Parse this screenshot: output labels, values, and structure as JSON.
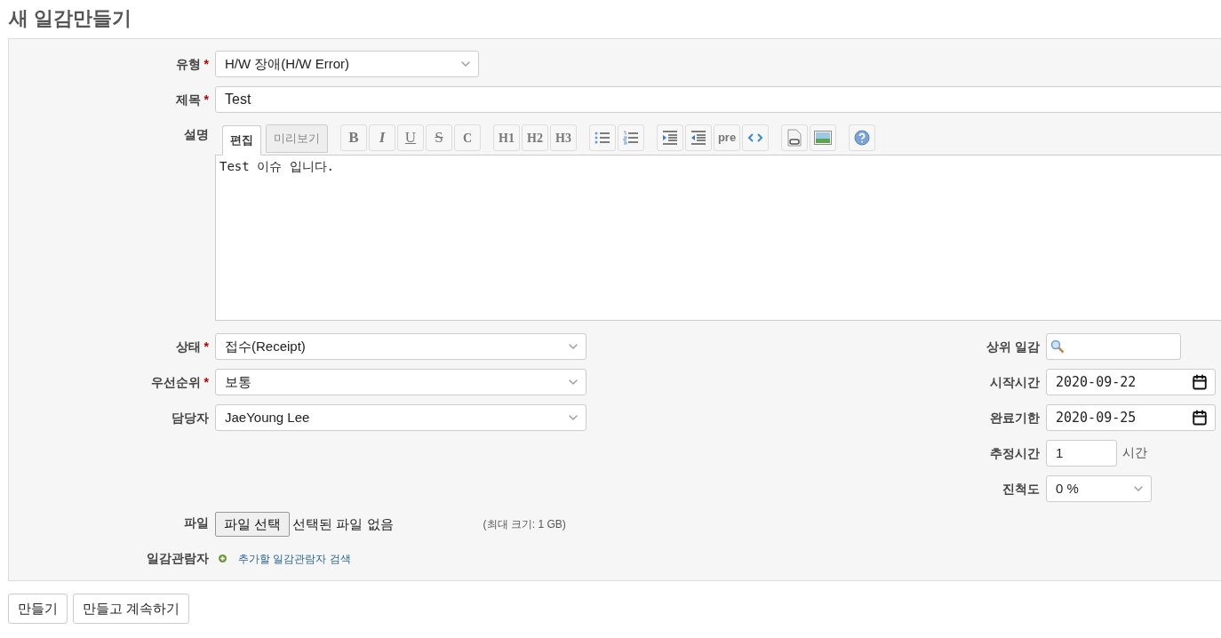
{
  "title": "새 일감만들기",
  "main_fields": [
    {
      "label": "유형",
      "required_mark": "*",
      "kind": "select",
      "value": "H/W 장애(H/W Error)"
    },
    {
      "label": "제목",
      "required_mark": "*",
      "kind": "text",
      "value": "Test"
    }
  ],
  "description": {
    "label": "설명",
    "tabs": [
      {
        "label": "편집",
        "selected": true
      },
      {
        "label": "미리보기",
        "selected": false
      }
    ],
    "toolbar": [
      [
        {
          "kind": "bold",
          "label": "B"
        },
        {
          "kind": "italic",
          "label": "I"
        },
        {
          "kind": "underline",
          "label": "U"
        },
        {
          "kind": "strike",
          "label": "S"
        },
        {
          "kind": "serif",
          "label": "C"
        }
      ],
      [
        {
          "kind": "serif",
          "label": "H1"
        },
        {
          "kind": "serif",
          "label": "H2"
        },
        {
          "kind": "serif",
          "label": "H3"
        }
      ],
      [
        {
          "kind": "ul"
        },
        {
          "kind": "ol"
        }
      ],
      [
        {
          "kind": "indent"
        },
        {
          "kind": "outdent"
        },
        {
          "kind": "plain",
          "label": "pre"
        },
        {
          "kind": "code"
        }
      ],
      [
        {
          "kind": "file"
        },
        {
          "kind": "image"
        }
      ],
      [
        {
          "kind": "help"
        }
      ]
    ],
    "value": "Test 이슈 입니다."
  },
  "left_fields": [
    {
      "label": "상태",
      "required_mark": "*",
      "value": "접수(Receipt)"
    },
    {
      "label": "우선순위",
      "required_mark": "*",
      "value": "보통"
    },
    {
      "label": "담당자",
      "value": "JaeYoung Lee"
    }
  ],
  "right_fields": [
    {
      "label": "상위 일감",
      "kind": "search"
    },
    {
      "label": "시작시간",
      "kind": "date",
      "value": "2020-09-22"
    },
    {
      "label": "완료기한",
      "kind": "date",
      "value": "2020-09-25"
    },
    {
      "label": "추정시간",
      "kind": "number",
      "value": "1",
      "unit": "시간"
    },
    {
      "label": "진척도",
      "kind": "select",
      "value": "0 %"
    }
  ],
  "file": {
    "label": "파일",
    "button": "파일 선택",
    "status": "선택된 파일 없음",
    "note": "(최대 크기: 1 GB)"
  },
  "watchers": {
    "label": "일감관람자",
    "link": "추가할 일감관람자 검색"
  },
  "buttons": [
    "만들기",
    "만들고 계속하기"
  ]
}
